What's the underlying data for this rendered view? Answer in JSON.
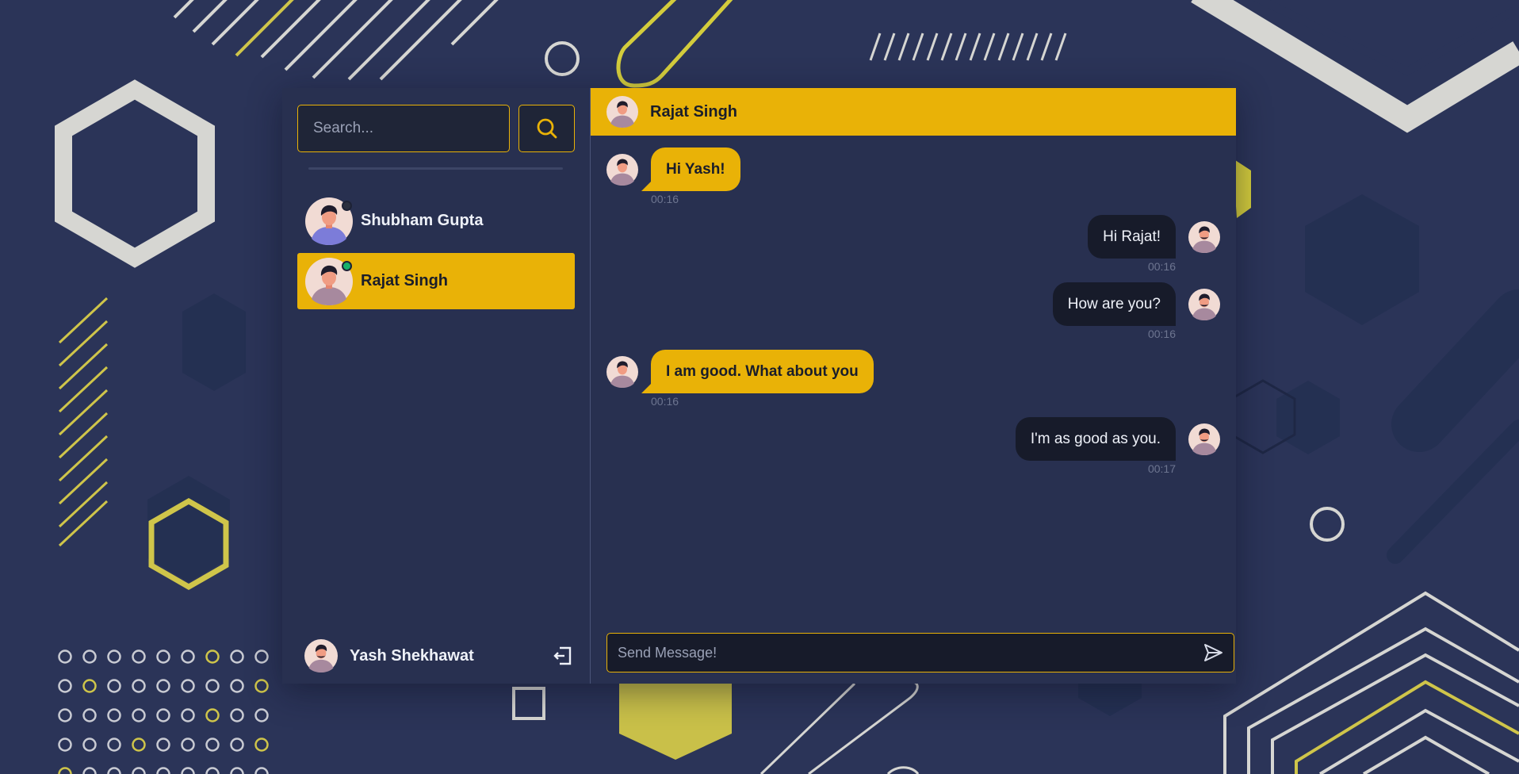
{
  "colors": {
    "accent": "#e9b207",
    "panel": "#283050",
    "dark_bubble": "#171b2a",
    "online": "#17b06b",
    "background": "#2b3458"
  },
  "sidebar": {
    "search": {
      "placeholder": "Search...",
      "button_icon": "search-icon"
    },
    "contacts": [
      {
        "name": "Shubham Gupta",
        "status": "offline",
        "active": false
      },
      {
        "name": "Rajat Singh",
        "status": "online",
        "active": true
      }
    ],
    "current_user": {
      "name": "Yash Shekhawat",
      "logout_icon": "logout-icon"
    }
  },
  "chat": {
    "header": {
      "name": "Rajat Singh"
    },
    "messages": [
      {
        "side": "left",
        "text": "Hi Yash!",
        "time": "00:16"
      },
      {
        "side": "right",
        "text": "Hi Rajat!",
        "time": "00:16"
      },
      {
        "side": "right",
        "text": "How are you?",
        "time": "00:16"
      },
      {
        "side": "left",
        "text": "I am good. What about you",
        "time": "00:16"
      },
      {
        "side": "right",
        "text": "I'm as good as you.",
        "time": "00:17"
      }
    ],
    "composer": {
      "placeholder": "Send Message!",
      "send_icon": "send-icon"
    }
  }
}
